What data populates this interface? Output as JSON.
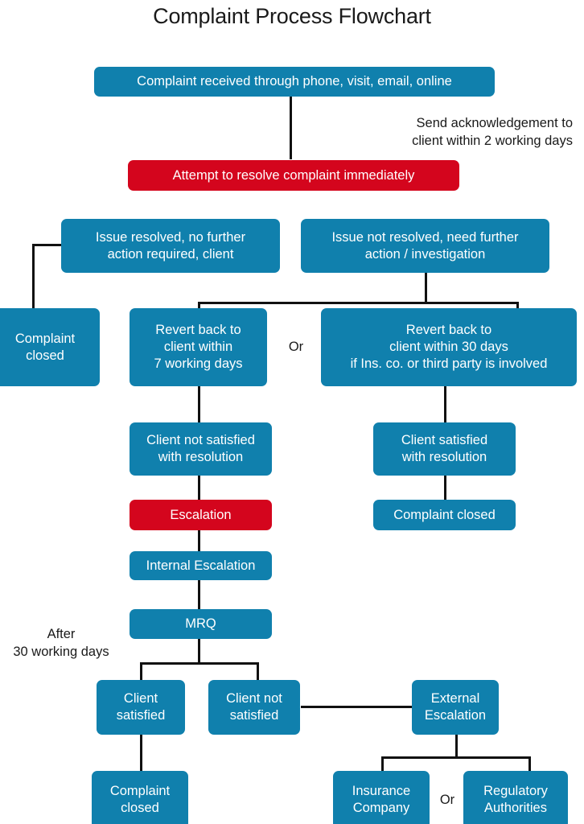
{
  "title": "Complaint Process Flowchart",
  "colors": {
    "blue": "#1080ad",
    "red": "#d4051d",
    "connector": "#111111",
    "background": "#ffffff",
    "text_on_fill": "#ffffff",
    "text_plain": "#1a1a1a"
  },
  "nodes": {
    "complaint_received": "Complaint received through phone, visit, email, online",
    "attempt_resolve": "Attempt to resolve complaint immediately",
    "issue_resolved": "Issue resolved, no further\naction required, client",
    "issue_not_resolved": "Issue not resolved, need further\naction / investigation",
    "complaint_closed_left": "Complaint\nclosed",
    "revert_7_days": "Revert back to\nclient within\n7 working days",
    "revert_30_days": "Revert back to\nclient within 30 days\nif Ins. co. or third party is involved",
    "client_not_satisfied_resolution": "Client not satisfied\nwith resolution",
    "client_satisfied_resolution": "Client satisfied\nwith resolution",
    "escalation": "Escalation",
    "complaint_closed_right": "Complaint closed",
    "internal_escalation": "Internal Escalation",
    "mrq": "MRQ",
    "client_satisfied": "Client\nsatisfied",
    "client_not_satisfied": "Client not\nsatisfied",
    "external_escalation": "External\nEscalation",
    "complaint_closed_bottom": "Complaint\nclosed",
    "insurance_company": "Insurance\nCompany",
    "regulatory_authorities": "Regulatory\nAuthorities"
  },
  "annotations": {
    "send_acknowledgement": "Send acknowledgement to\nclient within 2 working days",
    "or_upper": "Or",
    "after_30_working_days": "After\n30 working days",
    "or_lower": "Or"
  },
  "chart_data": {
    "type": "flowchart",
    "title": "Complaint Process Flowchart",
    "node_shape": "rounded-rectangle",
    "nodes": [
      {
        "id": "complaint_received",
        "label": "Complaint received through phone, visit, email, online",
        "fill": "#1080ad"
      },
      {
        "id": "attempt_resolve",
        "label": "Attempt to resolve complaint immediately",
        "fill": "#d4051d"
      },
      {
        "id": "issue_resolved",
        "label": "Issue resolved, no further action required, client",
        "fill": "#1080ad"
      },
      {
        "id": "issue_not_resolved",
        "label": "Issue not resolved, need further action / investigation",
        "fill": "#1080ad"
      },
      {
        "id": "complaint_closed_left",
        "label": "Complaint closed",
        "fill": "#1080ad"
      },
      {
        "id": "revert_7_days",
        "label": "Revert back to client within 7 working days",
        "fill": "#1080ad"
      },
      {
        "id": "revert_30_days",
        "label": "Revert back to client within 30 days if Ins. co. or third party is involved",
        "fill": "#1080ad"
      },
      {
        "id": "client_not_satisfied_resolution",
        "label": "Client not satisfied with resolution",
        "fill": "#1080ad"
      },
      {
        "id": "client_satisfied_resolution",
        "label": "Client satisfied with resolution",
        "fill": "#1080ad"
      },
      {
        "id": "escalation",
        "label": "Escalation",
        "fill": "#d4051d"
      },
      {
        "id": "complaint_closed_right",
        "label": "Complaint closed",
        "fill": "#1080ad"
      },
      {
        "id": "internal_escalation",
        "label": "Internal Escalation",
        "fill": "#1080ad"
      },
      {
        "id": "mrq",
        "label": "MRQ",
        "fill": "#1080ad"
      },
      {
        "id": "client_satisfied",
        "label": "Client satisfied",
        "fill": "#1080ad"
      },
      {
        "id": "client_not_satisfied",
        "label": "Client not satisfied",
        "fill": "#1080ad"
      },
      {
        "id": "external_escalation",
        "label": "External Escalation",
        "fill": "#1080ad"
      },
      {
        "id": "complaint_closed_bottom",
        "label": "Complaint closed",
        "fill": "#1080ad"
      },
      {
        "id": "insurance_company",
        "label": "Insurance Company",
        "fill": "#1080ad"
      },
      {
        "id": "regulatory_authorities",
        "label": "Regulatory Authorities",
        "fill": "#1080ad"
      }
    ],
    "edges": [
      {
        "from": "complaint_received",
        "to": "attempt_resolve",
        "label": "Send acknowledgement to client within 2 working days"
      },
      {
        "from": "issue_resolved",
        "to": "complaint_closed_left",
        "label": ""
      },
      {
        "from": "issue_not_resolved",
        "to": "revert_7_days",
        "label": "Or"
      },
      {
        "from": "issue_not_resolved",
        "to": "revert_30_days",
        "label": "Or"
      },
      {
        "from": "revert_7_days",
        "to": "client_not_satisfied_resolution",
        "label": ""
      },
      {
        "from": "revert_30_days",
        "to": "client_satisfied_resolution",
        "label": ""
      },
      {
        "from": "client_satisfied_resolution",
        "to": "complaint_closed_right",
        "label": ""
      },
      {
        "from": "client_not_satisfied_resolution",
        "to": "escalation",
        "label": ""
      },
      {
        "from": "escalation",
        "to": "internal_escalation",
        "label": ""
      },
      {
        "from": "internal_escalation",
        "to": "mrq",
        "label": ""
      },
      {
        "from": "mrq",
        "to": "client_satisfied",
        "label": "After 30 working days"
      },
      {
        "from": "mrq",
        "to": "client_not_satisfied",
        "label": "After 30 working days"
      },
      {
        "from": "client_satisfied",
        "to": "complaint_closed_bottom",
        "label": ""
      },
      {
        "from": "client_not_satisfied",
        "to": "external_escalation",
        "label": ""
      },
      {
        "from": "external_escalation",
        "to": "insurance_company",
        "label": "Or"
      },
      {
        "from": "external_escalation",
        "to": "regulatory_authorities",
        "label": "Or"
      }
    ]
  }
}
